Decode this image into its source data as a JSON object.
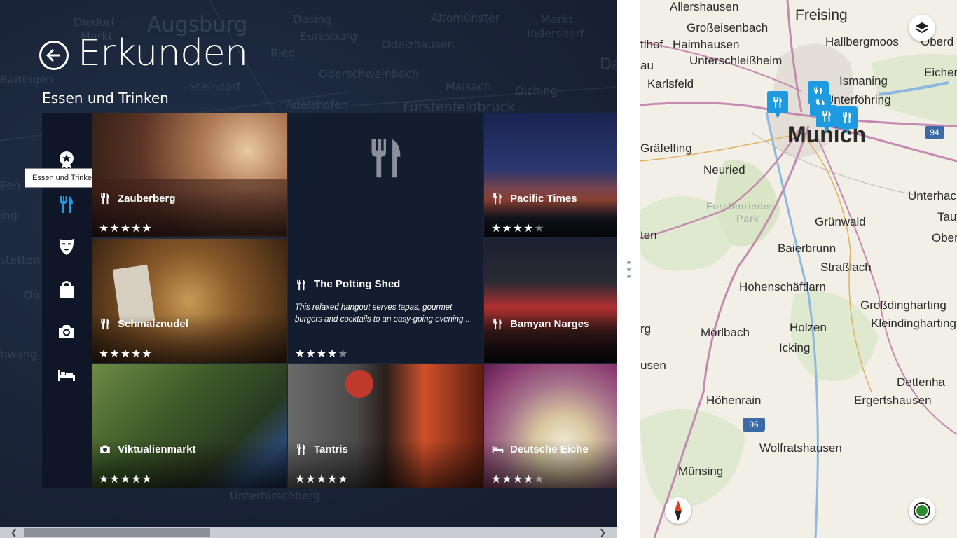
{
  "page": {
    "title": "Erkunden",
    "section": "Essen und Trinken",
    "tooltip": "Essen und Trinken"
  },
  "background_places": [
    "Augsburg",
    "Diedorf",
    "Markt",
    "Dasing",
    "Eurasburg",
    "Altomünster",
    "Markt",
    "Indersdorf",
    "Ried",
    "Odelzhausen",
    "Oberschweinbach",
    "Maisach",
    "Olching",
    "Steindorf",
    "Adelshofen",
    "Fürstenfeldbruck",
    "Baitingen",
    "Unterhirschberg",
    "Pen",
    "ing",
    "stetten",
    "Ob",
    "hwang",
    "Da"
  ],
  "categories": [
    {
      "id": "highlights",
      "icon": "star-badge-icon",
      "label": "Highlights"
    },
    {
      "id": "food",
      "icon": "fork-knife-icon",
      "label": "Essen und Trinken",
      "selected": true
    },
    {
      "id": "entertainment",
      "icon": "theater-mask-icon",
      "label": "Unterhaltung"
    },
    {
      "id": "shopping",
      "icon": "shopping-bag-icon",
      "label": "Einkaufen"
    },
    {
      "id": "sights",
      "icon": "camera-icon",
      "label": "Sehenswürdigkeiten"
    },
    {
      "id": "hotels",
      "icon": "bed-icon",
      "label": "Hotels"
    }
  ],
  "tiles": [
    {
      "name": "Zauberberg",
      "type": "restaurant",
      "icon": "fork-knife-icon",
      "rating": 5
    },
    {
      "name": "The Potting Shed",
      "type": "restaurant",
      "icon": "fork-knife-icon",
      "rating": 4,
      "description": "This relaxed hangout serves tapas, gourmet burgers and cocktails to an easy-going evening..."
    },
    {
      "name": "Pacific Times",
      "type": "restaurant",
      "icon": "fork-knife-icon",
      "rating": 4
    },
    {
      "name": "Schmalznudel",
      "type": "restaurant",
      "icon": "fork-knife-icon",
      "rating": 5
    },
    {
      "name": "Bamyan Narges",
      "type": "restaurant",
      "icon": "fork-knife-icon",
      "rating": 0
    },
    {
      "name": "Viktualienmarkt",
      "type": "sight",
      "icon": "camera-icon",
      "rating": 5
    },
    {
      "name": "Tantris",
      "type": "restaurant",
      "icon": "fork-knife-icon",
      "rating": 5
    },
    {
      "name": "Deutsche Eiche",
      "type": "hotel",
      "icon": "bed-icon",
      "rating": 4
    }
  ],
  "map": {
    "places": [
      "Allershausen",
      "Freising",
      "Großeisenbach",
      "Hallbergmoos",
      "Oberd",
      "tlhof",
      "Haimhausen",
      "Unterschleißheim",
      "au",
      "Ismaning",
      "Eicher",
      "Karlsfeld",
      "Unterföhring",
      "Munich",
      "Gräfelfing",
      "Neuried",
      "Unterhach",
      "Forstenrieder",
      "Park",
      "Grünwald",
      "Tauf",
      "ten",
      "Ober",
      "Baierbrunn",
      "Straßlach",
      "Hohenschäftlarn",
      "Großdingharting",
      "Kleindingharting",
      "Holzen",
      "Mörlbach",
      "rg",
      "Icking",
      "usen",
      "Dettenha",
      "Höhenrain",
      "Ergertshausen",
      "Wolfratshausen",
      "Münsing"
    ],
    "road_shields": [
      "94",
      "95"
    ],
    "layers_icon": "layers-icon",
    "compass_icon": "compass-icon",
    "locate_icon": "location-icon"
  },
  "colors": {
    "panel_bg": "#1b2335",
    "rail_bg": "#0f1628",
    "accent": "#1e9be0",
    "map_bg": "#f1efe6",
    "road": "#c48ab0"
  }
}
